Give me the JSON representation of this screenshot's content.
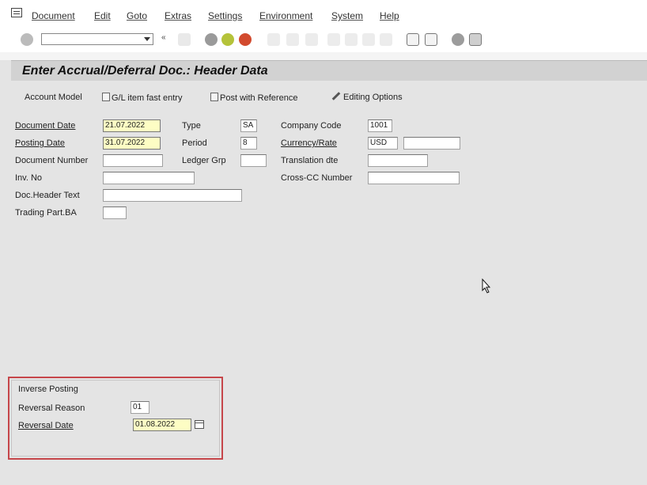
{
  "menu": {
    "items": [
      "Document",
      "Edit",
      "Goto",
      "Extras",
      "Settings",
      "Environment",
      "System",
      "Help"
    ]
  },
  "toolbar": {
    "command_field_value": ""
  },
  "page": {
    "title": "Enter Accrual/Deferral Doc.: Header Data"
  },
  "app_toolbar": {
    "account_model": "Account Model",
    "gl_item_fast_entry": "G/L item fast entry",
    "post_with_reference": "Post with Reference",
    "editing_options": "Editing Options"
  },
  "header": {
    "document_date_label": "Document Date",
    "document_date_value": "21.07.2022",
    "posting_date_label": "Posting Date",
    "posting_date_value": "31.07.2022",
    "document_number_label": "Document Number",
    "document_number_value": "",
    "inv_no_label": "Inv. No",
    "inv_no_value": "",
    "doc_header_text_label": "Doc.Header Text",
    "doc_header_text_value": "",
    "trading_part_ba_label": "Trading Part.BA",
    "trading_part_ba_value": "",
    "type_label": "Type",
    "type_value": "SA",
    "period_label": "Period",
    "period_value": "8",
    "ledger_grp_label": "Ledger Grp",
    "ledger_grp_value": "",
    "company_code_label": "Company Code",
    "company_code_value": "1001",
    "currency_rate_label": "Currency/Rate",
    "currency_value": "USD",
    "rate_value": "",
    "translation_dte_label": "Translation dte",
    "translation_dte_value": "",
    "cross_cc_number_label": "Cross-CC Number",
    "cross_cc_number_value": ""
  },
  "inverse_posting": {
    "title": "Inverse Posting",
    "reversal_reason_label": "Reversal Reason",
    "reversal_reason_value": "01",
    "reversal_date_label": "Reversal Date",
    "reversal_date_value": "01.08.2022"
  },
  "colors": {
    "background": "#e4e4e4",
    "title_bar": "#d2d2d2",
    "highlight_border": "#c6464a",
    "required_field": "#fdfdc4"
  }
}
